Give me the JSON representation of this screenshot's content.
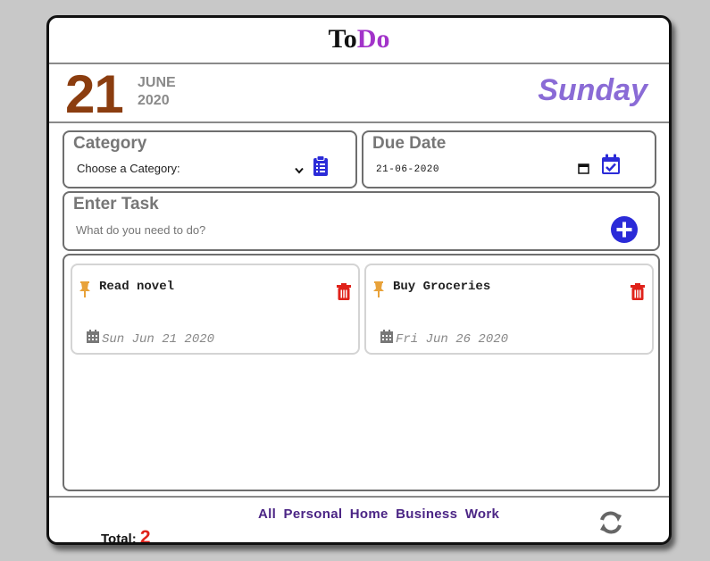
{
  "app": {
    "title_part1": "To",
    "title_part2": "Do"
  },
  "date": {
    "day": "21",
    "month": "JUNE",
    "year": "2020",
    "weekday": "Sunday"
  },
  "category": {
    "label": "Category",
    "selected": "Choose a Category:"
  },
  "due": {
    "label": "Due Date",
    "value": "21-06-2020"
  },
  "task_entry": {
    "label": "Enter Task",
    "placeholder": "What do you need to do?"
  },
  "tasks": [
    {
      "text": "Read novel",
      "date": "Sun Jun 21 2020"
    },
    {
      "text": "Buy Groceries",
      "date": "Fri Jun 26 2020"
    }
  ],
  "filters": [
    "All",
    "Personal",
    "Home",
    "Business",
    "Work"
  ],
  "total": {
    "label": "Total:",
    "count": "2"
  },
  "colors": {
    "accent_title": "#a233c9",
    "day_number": "#8b3d0f",
    "weekday": "#8a6bd6",
    "icon_blue": "#2b2bd8",
    "trash_red": "#e0221a",
    "pin_orange": "#e8a23a"
  }
}
